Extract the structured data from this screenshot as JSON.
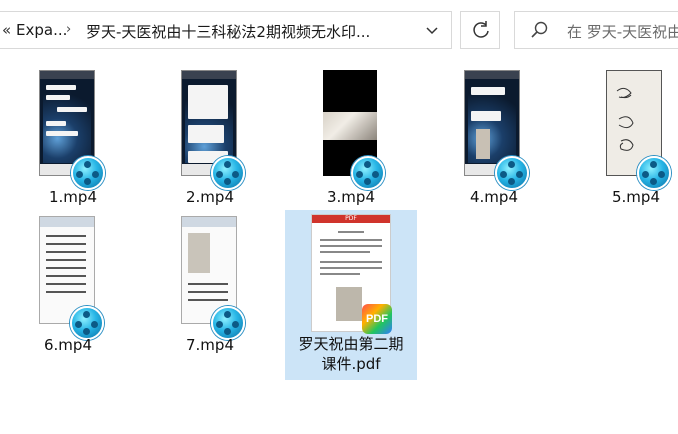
{
  "address_bar": {
    "overflow_chevron": "«",
    "crumb1": "Expa...",
    "separator": "›",
    "crumb2": "罗天-天医祝由十三科秘法2期视频无水印...",
    "dropdown_icon": "chevron-down-icon"
  },
  "refresh": {
    "icon": "refresh-icon"
  },
  "search": {
    "icon": "search-icon",
    "placeholder": "在 罗天-天医祝由"
  },
  "files": [
    {
      "name": "1.mp4",
      "kind": "video"
    },
    {
      "name": "2.mp4",
      "kind": "video"
    },
    {
      "name": "3.mp4",
      "kind": "video"
    },
    {
      "name": "4.mp4",
      "kind": "video"
    },
    {
      "name": "5.mp4",
      "kind": "video"
    },
    {
      "name": "6.mp4",
      "kind": "video"
    },
    {
      "name": "7.mp4",
      "kind": "video"
    },
    {
      "name": "罗天祝由第二期课件.pdf",
      "kind": "pdf",
      "label_line1": "罗天祝由第二期",
      "label_line2": "课件.pdf",
      "badge": "PDF",
      "header": "PDF"
    }
  ],
  "colors": {
    "selection": "#cce4f7",
    "border": "#d9d9d9"
  }
}
